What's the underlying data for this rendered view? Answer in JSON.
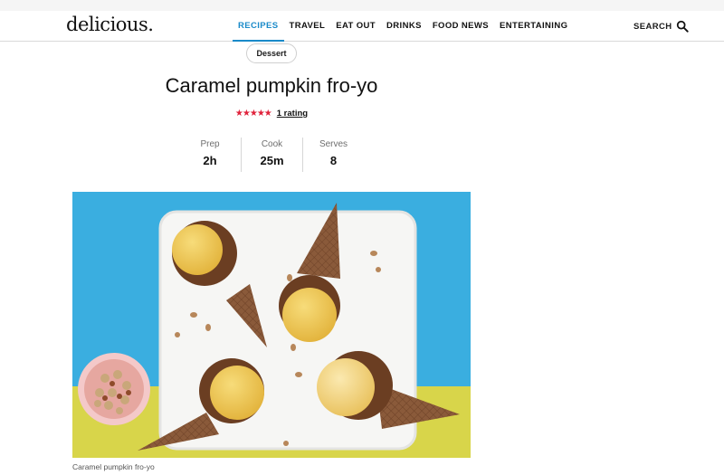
{
  "site": {
    "logo": "delicious."
  },
  "nav": {
    "items": [
      {
        "label": "RECIPES",
        "active": true
      },
      {
        "label": "TRAVEL",
        "active": false
      },
      {
        "label": "EAT OUT",
        "active": false
      },
      {
        "label": "DRINKS",
        "active": false
      },
      {
        "label": "FOOD NEWS",
        "active": false
      },
      {
        "label": "ENTERTAINING",
        "active": false
      }
    ],
    "search_label": "SEARCH"
  },
  "recipe": {
    "category": "Dessert",
    "title": "Caramel pumpkin fro-yo",
    "stars": "★★★★★",
    "star_value": 5,
    "rating_text": "1 rating",
    "facts": [
      {
        "label": "Prep",
        "value": "2h"
      },
      {
        "label": "Cook",
        "value": "25m"
      },
      {
        "label": "Serves",
        "value": "8"
      }
    ],
    "image_caption": "Caramel pumpkin fro-yo"
  },
  "colors": {
    "accent": "#1a8ac9",
    "star": "#e0223b",
    "background_blue": "#3aaee0",
    "background_yellow": "#d8d54a"
  }
}
